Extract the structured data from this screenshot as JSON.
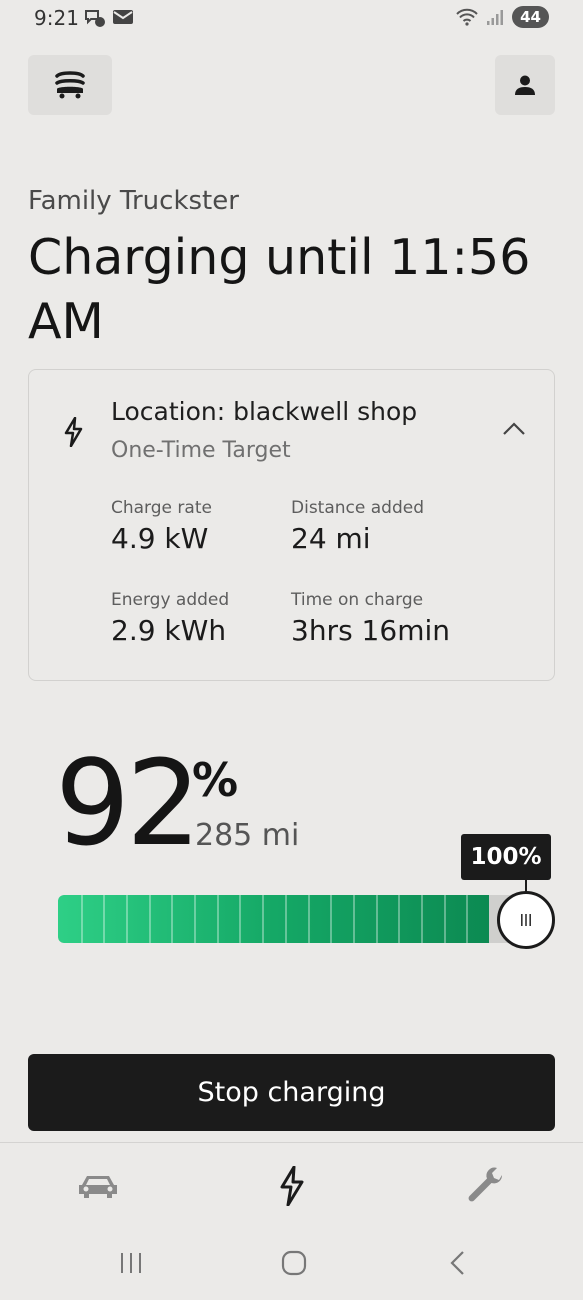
{
  "status_bar": {
    "time": "9:21",
    "battery": "44",
    "icons": [
      "chat-bubbles-icon",
      "mail-icon",
      "wifi-icon",
      "signal-icon"
    ]
  },
  "header": {
    "menu_icon": "vehicle-stack-icon",
    "account_icon": "person-icon"
  },
  "vehicle_name": "Family Truckster",
  "headline": "Charging until 11:56 AM",
  "charge_card": {
    "icon": "bolt-icon",
    "location": "Location: blackwell shop",
    "target": "One-Time Target",
    "expanded": true,
    "stats": [
      {
        "label": "Charge rate",
        "value": "4.9 kW"
      },
      {
        "label": "Distance added",
        "value": "24 mi"
      },
      {
        "label": "Energy added",
        "value": "2.9 kWh"
      },
      {
        "label": "Time on charge",
        "value": "3hrs 16min"
      }
    ]
  },
  "battery": {
    "percent": "92",
    "percent_sign": "%",
    "range": "285 mi",
    "level": 0.92,
    "limit_label": "100%",
    "limit": 1.0,
    "fill_color": "#15a866"
  },
  "stop_button": {
    "label": "Stop charging"
  },
  "tab_bar": {
    "tabs": [
      {
        "name": "vehicle",
        "icon": "car-icon",
        "active": false
      },
      {
        "name": "charging",
        "icon": "bolt-icon",
        "active": true
      },
      {
        "name": "service",
        "icon": "wrench-icon",
        "active": false
      }
    ]
  },
  "system_nav": [
    "recent-apps-icon",
    "home-icon",
    "back-icon"
  ]
}
